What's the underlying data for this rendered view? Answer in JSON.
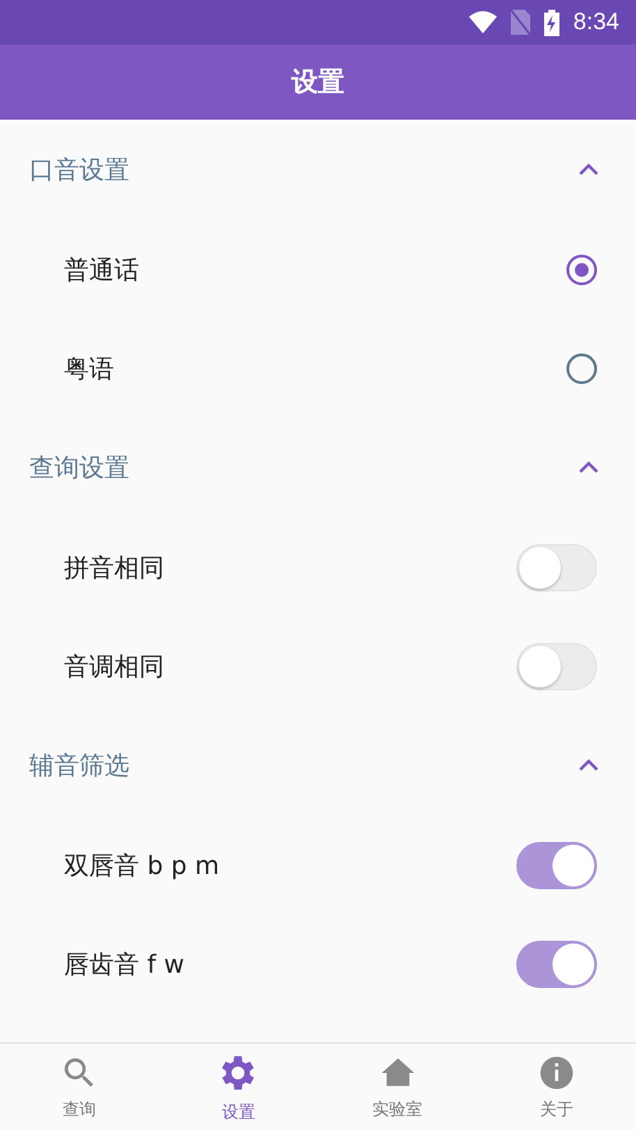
{
  "status_bar": {
    "time": "8:34"
  },
  "app_bar": {
    "title": "设置"
  },
  "sections": [
    {
      "title": "口音设置",
      "expanded": true,
      "items": [
        {
          "kind": "radio",
          "label": "普通话",
          "selected": true
        },
        {
          "kind": "radio",
          "label": "粤语",
          "selected": false
        }
      ]
    },
    {
      "title": "查询设置",
      "expanded": true,
      "items": [
        {
          "kind": "switch",
          "label": "拼音相同",
          "on": false
        },
        {
          "kind": "switch",
          "label": "音调相同",
          "on": false
        }
      ]
    },
    {
      "title": "辅音筛选",
      "expanded": true,
      "items": [
        {
          "kind": "switch",
          "label": "双唇音 b p m",
          "on": true
        },
        {
          "kind": "switch",
          "label": "唇齿音 f w",
          "on": true
        }
      ]
    }
  ],
  "bottom_nav": [
    {
      "kind": "search",
      "label": "查询",
      "selected": false
    },
    {
      "kind": "settings",
      "label": "设置",
      "selected": true
    },
    {
      "kind": "lab",
      "label": "实验室",
      "selected": false
    },
    {
      "kind": "info",
      "label": "关于",
      "selected": false
    }
  ]
}
